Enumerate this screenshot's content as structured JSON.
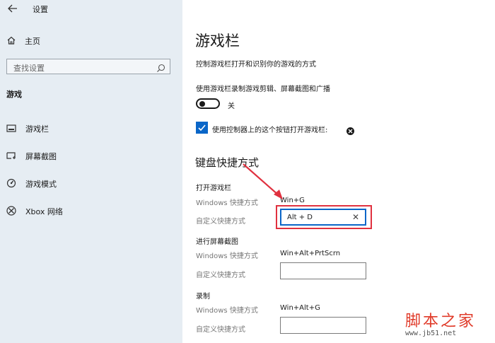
{
  "window": {
    "title": "设置"
  },
  "sidebar": {
    "home_label": "主页",
    "search_placeholder": "查找设置",
    "section_title": "游戏",
    "items": [
      {
        "label": "游戏栏",
        "icon": "game-bar-icon"
      },
      {
        "label": "屏幕截图",
        "icon": "screenshot-icon"
      },
      {
        "label": "游戏模式",
        "icon": "game-mode-icon"
      },
      {
        "label": "Xbox 网络",
        "icon": "xbox-icon"
      }
    ]
  },
  "main": {
    "title": "游戏栏",
    "description": "控制游戏栏打开和识别你的游戏的方式",
    "record_label": "使用游戏栏录制游戏剪辑、屏幕截图和广播",
    "toggle_state": "关",
    "checkbox_label": "使用控制器上的这个按钮打开游戏栏:",
    "shortcuts_title": "键盘快捷方式",
    "groups": [
      {
        "title": "打开游戏栏",
        "windows_label": "Windows 快捷方式",
        "windows_value": "Win+G",
        "custom_label": "自定义快捷方式",
        "custom_value": "Alt + D"
      },
      {
        "title": "进行屏幕截图",
        "windows_label": "Windows 快捷方式",
        "windows_value": "Win+Alt+PrtScrn",
        "custom_label": "自定义快捷方式",
        "custom_value": ""
      },
      {
        "title": "录制",
        "windows_label": "Windows 快捷方式",
        "windows_value": "Win+Alt+G",
        "custom_label": "自定义快捷方式",
        "custom_value": ""
      }
    ]
  },
  "watermark": {
    "big": "脚本之家",
    "small": "www.jb51.net"
  },
  "colors": {
    "accent": "#0a66c8",
    "highlight": "#e0313f",
    "sidebar_bg": "#e6edf3"
  }
}
